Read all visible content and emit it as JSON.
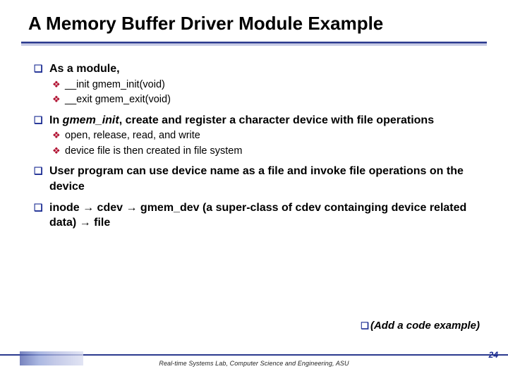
{
  "title": "A Memory Buffer Driver Module Example",
  "bullets": {
    "b1": "As a module,",
    "b1_1": "__init   gmem_init(void)",
    "b1_2": "__exit  gmem_exit(void)",
    "b2_pre": "In ",
    "b2_em": "gmem_init",
    "b2_post": ", create and register a character device with file operations",
    "b2_1": "open, release, read, and write",
    "b2_2": "device file is then created in file system",
    "b3": "User program can use device name as a file and invoke file operations on the device",
    "b4_pre": "inode ",
    "b4_a1": "→",
    "b4_m1": " cdev ",
    "b4_a2": "→",
    "b4_m2": " gmem_dev (a super-class of cdev containging device related data) ",
    "b4_a3": "→",
    "b4_post": " file"
  },
  "addnote": "(Add a code example)",
  "footer": "Real-time Systems Lab, Computer Science and Engineering, ASU",
  "page": "24"
}
